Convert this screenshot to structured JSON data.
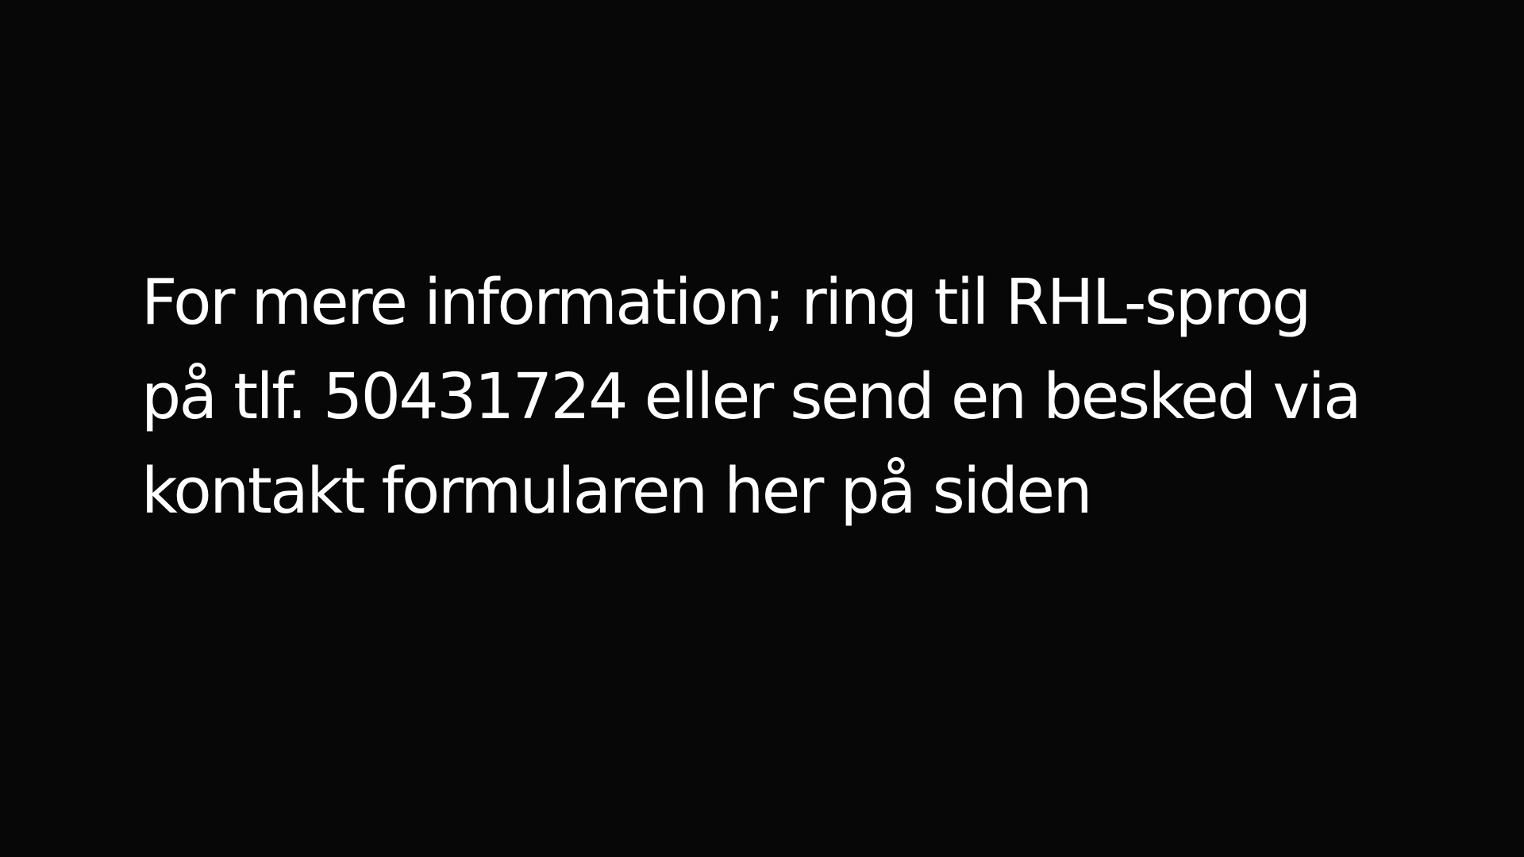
{
  "colors": {
    "background": "#070707",
    "text": "#ffffff"
  },
  "message": {
    "lines": [
      "For mere information; ring til RHL-sprog",
      "på tlf. 50431724 eller send en besked via",
      "kontakt formularen her på siden"
    ]
  }
}
